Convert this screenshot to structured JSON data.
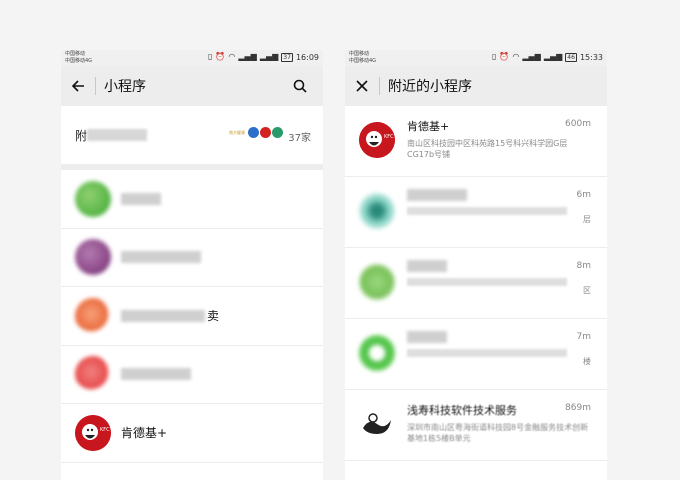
{
  "left": {
    "status": {
      "carrier_line1": "中国移动",
      "carrier_line2": "中国移动4G",
      "battery": "37",
      "time": "16:09"
    },
    "header": {
      "title": "小程序"
    },
    "nearby": {
      "label": "附",
      "count": "37家",
      "logo_text": "南方健康"
    },
    "apps": [
      {
        "name": "",
        "icon": "green-app-icon",
        "color": "#5cb84a"
      },
      {
        "name": "",
        "icon": "purple-app-icon",
        "color": "#8e4a8a"
      },
      {
        "name_tail": "卖",
        "icon": "orange-app-icon",
        "color": "#ea6a3c"
      },
      {
        "name": "",
        "icon": "red-app-icon",
        "color": "#e84a4a"
      },
      {
        "name": "肯德基+",
        "icon": "kfc-logo-icon",
        "color": "#d4221e"
      }
    ]
  },
  "right": {
    "status": {
      "carrier_line1": "中国移动",
      "carrier_line2": "中国移动4G",
      "battery": "46",
      "time": "15:33"
    },
    "header": {
      "title": "附近的小程序"
    },
    "places": [
      {
        "name": "肯德基+",
        "distance": "600m",
        "address": "南山区科技园中区科苑路15号科兴科学园G层CG17b号铺",
        "icon": "kfc-logo-icon"
      },
      {
        "distance": "6m",
        "address_tail": "层",
        "icon": "teal-app-icon",
        "color": "#3fb0a0"
      },
      {
        "distance": "8m",
        "address_tail": "区",
        "icon": "green-app-icon",
        "color": "#7ac25a"
      },
      {
        "distance": "7m",
        "address_tail": "楼",
        "icon": "green-app-icon",
        "color": "#48c040"
      },
      {
        "name": "浅寿科技软件技术服务",
        "distance": "869m",
        "address": "深圳市南山区粤海街道科技园8号金融服务技术创新基地1栋5楼B单元",
        "icon": "dark-logo-icon"
      }
    ]
  }
}
